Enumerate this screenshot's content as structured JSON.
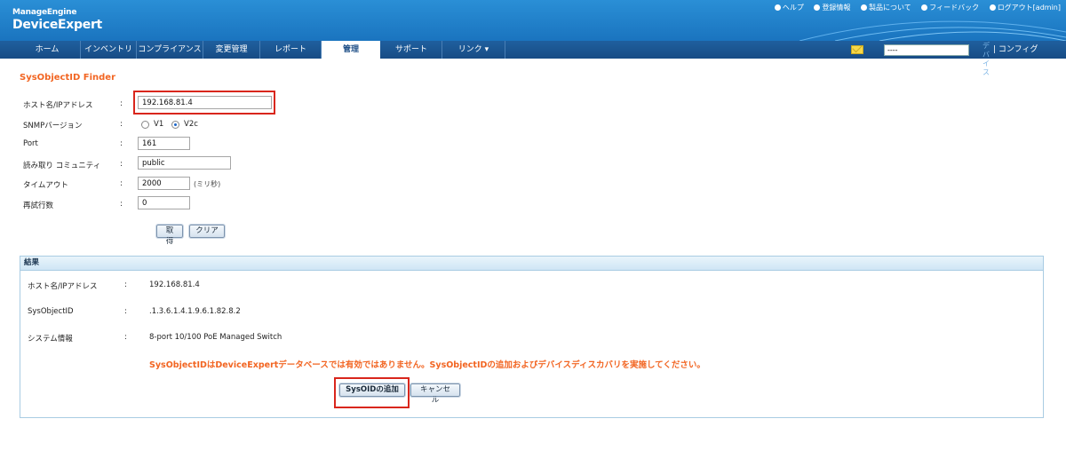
{
  "header": {
    "brand_top": "ManageEngine",
    "brand_main": "DeviceExpert",
    "links": [
      {
        "label": "ヘルプ",
        "icon": "help-icon"
      },
      {
        "label": "登録情報",
        "icon": "register-icon"
      },
      {
        "label": "製品について",
        "icon": "info-icon"
      },
      {
        "label": "フィードバック",
        "icon": "feedback-icon"
      },
      {
        "label": "ログアウト[admin]",
        "icon": "logout-icon"
      }
    ]
  },
  "nav": {
    "tabs": [
      "ホーム",
      "インベントリ",
      "コンプライアンス",
      "変更管理",
      "レポート",
      "管理",
      "サポート",
      "リンク ▾"
    ],
    "active_tab": "管理",
    "search_value": "----",
    "search_button": "デバイス",
    "config_label": "|  コンフィグ"
  },
  "form": {
    "title": "SysObjectID Finder",
    "rows": {
      "host": {
        "label": "ホスト名/IPアドレス",
        "value": "192.168.81.4"
      },
      "snmp": {
        "label": "SNMPバージョン",
        "v1": "V1",
        "v2c": "V2c",
        "selected": "V2c"
      },
      "port": {
        "label": "Port",
        "value": "161"
      },
      "community": {
        "label": "読み取り コミュニティ",
        "value": "public"
      },
      "timeout": {
        "label": "タイムアウト",
        "value": "2000",
        "unit": "(ミリ秒)"
      },
      "retries": {
        "label": "再試行数",
        "value": "0"
      }
    },
    "colon": ":",
    "get_button": "取得",
    "clear_button": "クリア"
  },
  "results": {
    "heading": "結果",
    "rows": [
      {
        "label": "ホスト名/IPアドレス",
        "value": "192.168.81.4"
      },
      {
        "label": "SysObjectID",
        "value": ".1.3.6.1.4.1.9.6.1.82.8.2"
      },
      {
        "label": "システム情報",
        "value": "8-port 10/100 PoE Managed Switch"
      }
    ],
    "warning": "SysObjectIDはDeviceExpertデータベースでは有効ではありません。SysObjectIDの追加およびデバイスディスカバリを実施してください。",
    "add_button": "SysOIDの追加",
    "cancel_button": "キャンセル"
  },
  "colors": {
    "accent_orange": "#f26522",
    "highlight_red": "#d9261c",
    "header_blue": "#1a74bf",
    "nav_blue": "#174c85"
  }
}
